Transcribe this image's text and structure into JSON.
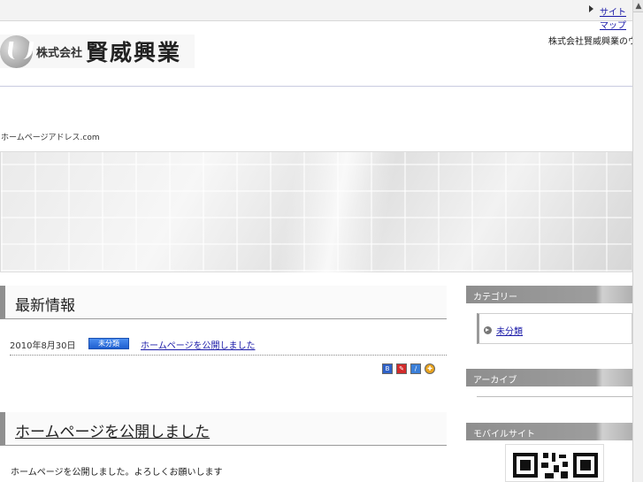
{
  "topbar": {
    "sitemap_label": "サイトマップ"
  },
  "header": {
    "logo_kk": "株式会社",
    "logo_name": "賢威興業",
    "tagline": "株式会社賢威興業のウェブサイトへようこそ"
  },
  "site_url": "ホームページアドレス.com",
  "posts": [
    {
      "title": "最新情報",
      "date": "2010年8月30日",
      "category": "未分類",
      "link": "ホームページを公開しました"
    },
    {
      "title": "ホームページを公開しました",
      "body": "ホームページを公開しました。よろしくお願いします"
    }
  ],
  "share_icons": [
    "bookmark-icon",
    "clip-icon",
    "link-icon",
    "share-icon"
  ],
  "sidebar": {
    "categories_heading": "カテゴリー",
    "categories": [
      {
        "label": "未分類"
      }
    ],
    "archive_heading": "アーカイブ",
    "qr_heading": "モバイルサイト"
  },
  "colors": {
    "accent": "#1f5fcf",
    "link": "#1a1aa8",
    "sidebar_heading": "#9d9d9d"
  }
}
